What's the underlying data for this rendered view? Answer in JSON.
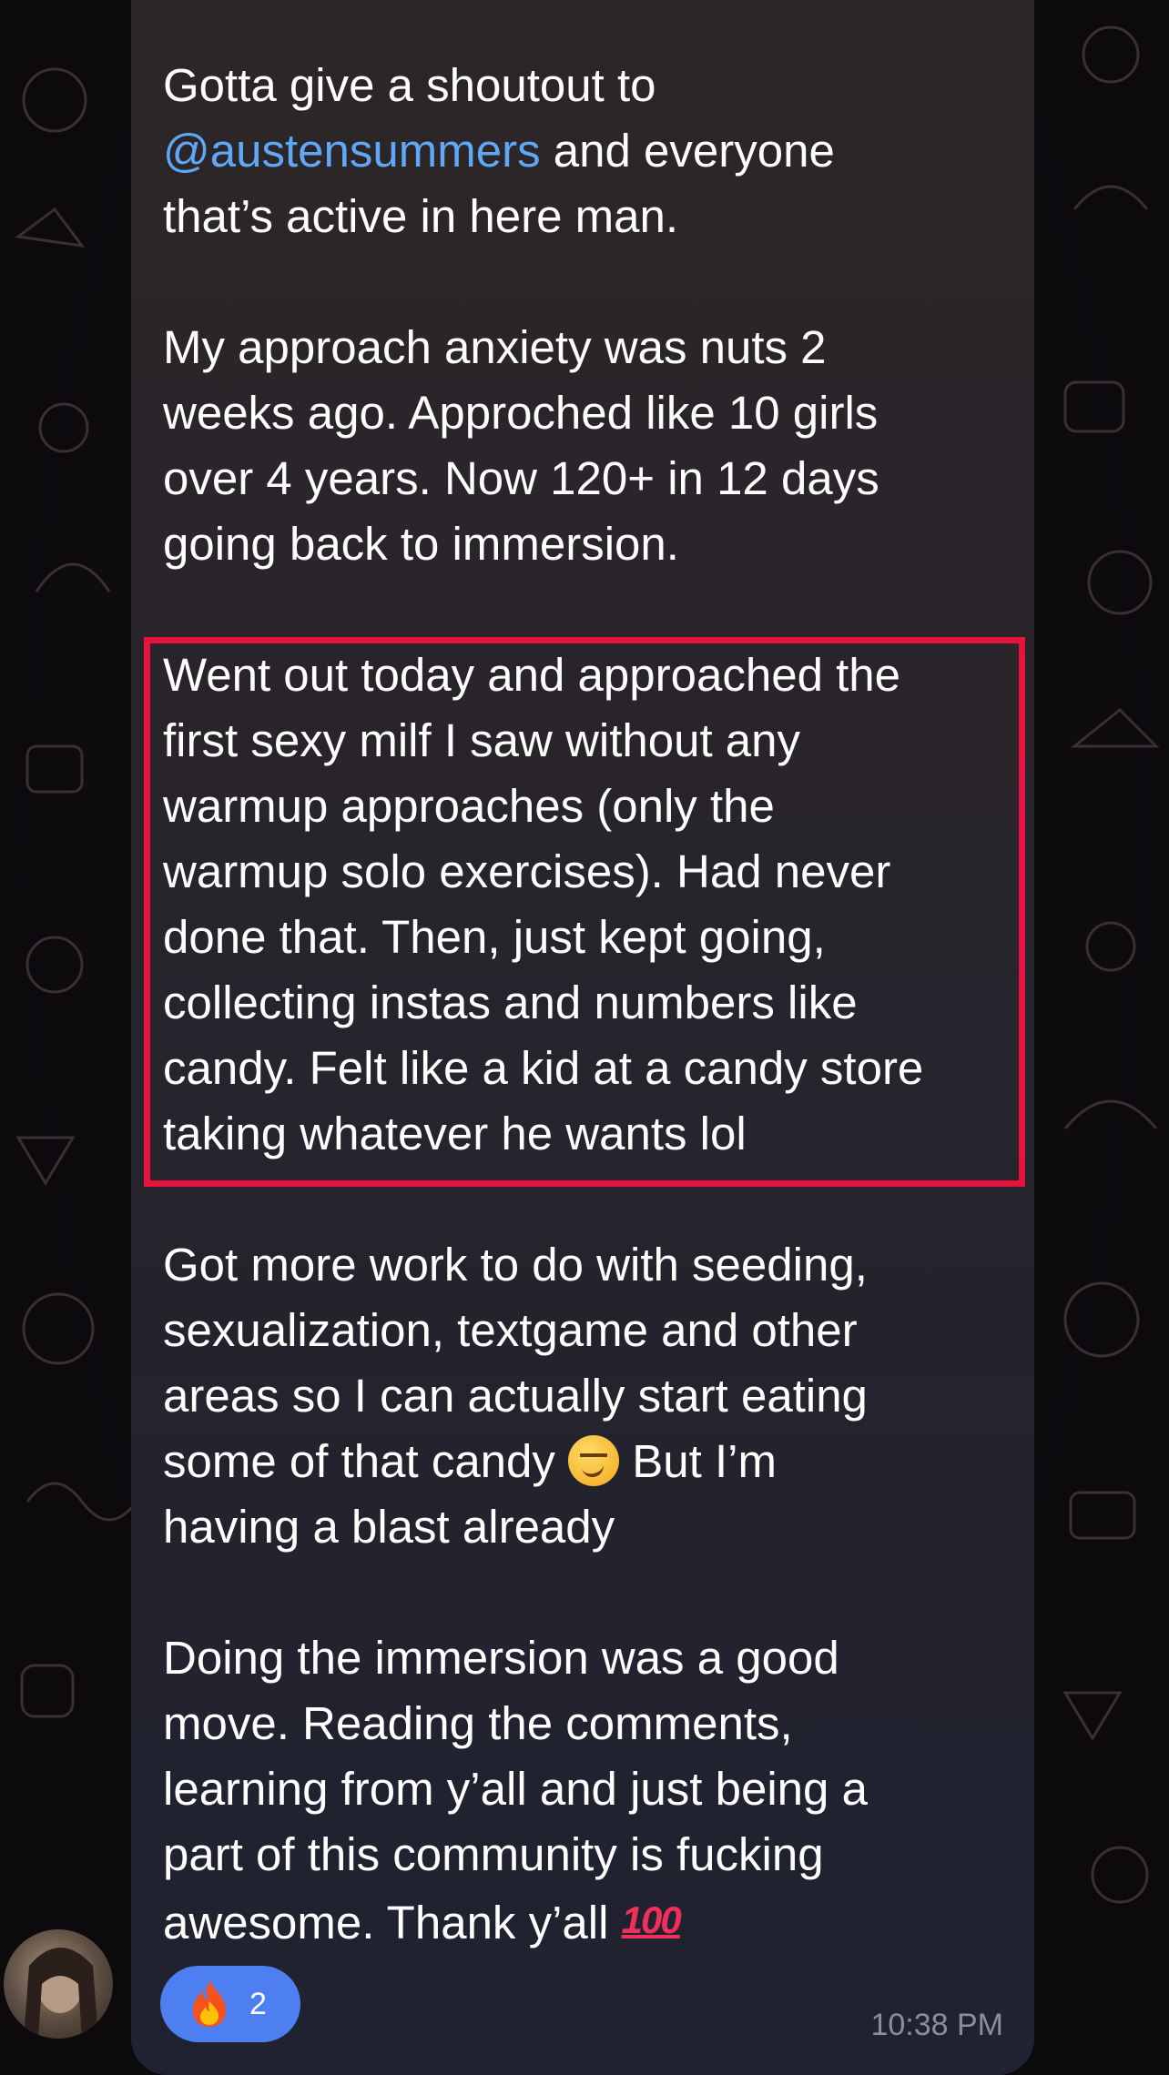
{
  "message": {
    "p1_before": "Gotta give a shoutout to\n",
    "p1_mention": "@austensummers",
    "p1_after": " and everyone\nthat’s active in here man.",
    "p2": "My approach anxiety was nuts 2\nweeks ago. Approched like 10 girls\nover 4 years. Now 120+ in 12 days\ngoing back to immersion.",
    "p3": "Went out today and approached the\nfirst sexy milf I saw without any\nwarmup approaches (only the\nwarmup solo exercises). Had never\ndone that. Then, just kept going,\ncollecting instas and numbers like\ncandy. Felt like a kid at a candy store\ntaking whatever he wants lol",
    "p4_before": "Got more work to do with seeding,\nsexualization, textgame and other\nareas so I can actually start eating\nsome of that candy ",
    "p4_after": " But I’m\nhaving a blast already",
    "p5_before": "Doing the immersion was a good\nmove. Reading the comments,\nlearning from y’all and just being a\npart of this community is fucking\nawesome. Thank y’all ",
    "emoji_100": "100"
  },
  "reaction": {
    "icon": "fire-icon",
    "count": "2"
  },
  "timestamp": "10:38 PM",
  "colors": {
    "mention": "#5ea8f5",
    "highlight_border": "#e8123e",
    "reaction_bg": "#4d7ff0"
  }
}
